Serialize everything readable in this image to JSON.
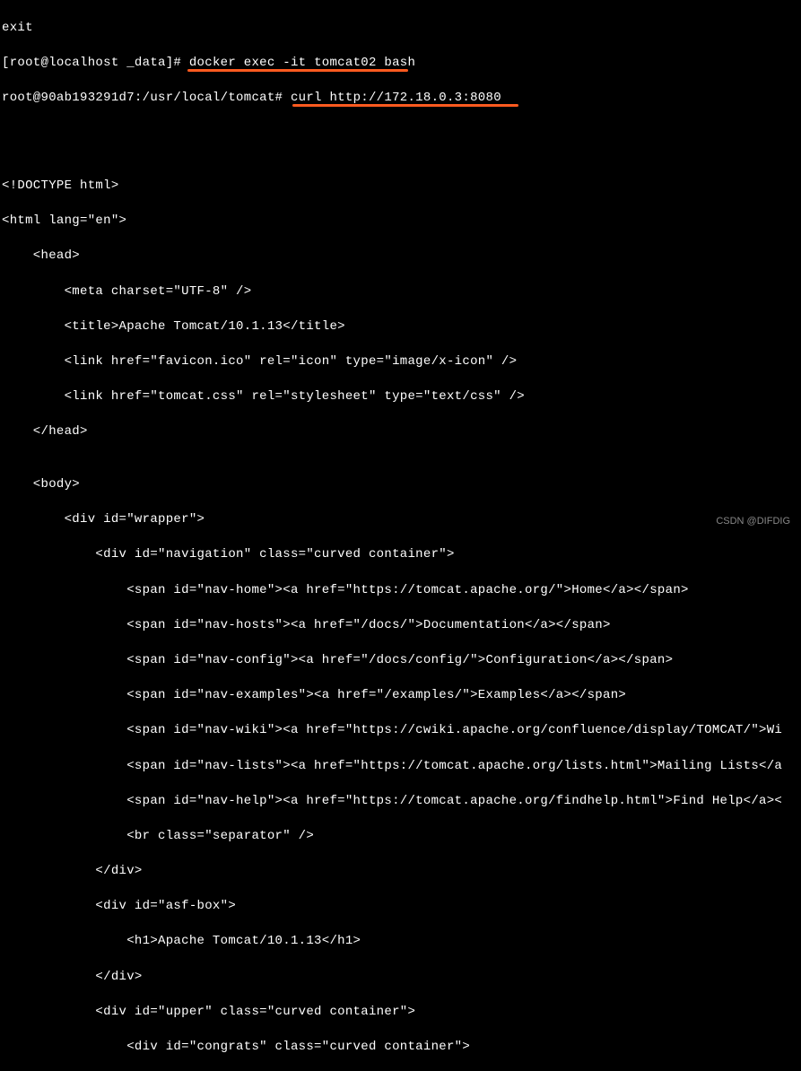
{
  "lines": {
    "l0": "exit",
    "l1_prompt": "[root@localhost _data]# ",
    "l1_cmd": "docker exec -it tomcat02 bash",
    "l2_prompt": "root@90ab193291d7:/usr/local/tomcat# ",
    "l2_cmd": "curl http://172.18.0.3:8080",
    "l3": "",
    "l4": "",
    "l5": "",
    "l6": "<!DOCTYPE html>",
    "l7": "<html lang=\"en\">",
    "l8": "    <head>",
    "l9": "        <meta charset=\"UTF-8\" />",
    "l10": "        <title>Apache Tomcat/10.1.13</title>",
    "l11": "        <link href=\"favicon.ico\" rel=\"icon\" type=\"image/x-icon\" />",
    "l12": "        <link href=\"tomcat.css\" rel=\"stylesheet\" type=\"text/css\" />",
    "l13": "    </head>",
    "l14": "",
    "l15": "    <body>",
    "l16": "        <div id=\"wrapper\">",
    "l17": "            <div id=\"navigation\" class=\"curved container\">",
    "l18": "                <span id=\"nav-home\"><a href=\"https://tomcat.apache.org/\">Home</a></span>",
    "l19": "                <span id=\"nav-hosts\"><a href=\"/docs/\">Documentation</a></span>",
    "l20": "                <span id=\"nav-config\"><a href=\"/docs/config/\">Configuration</a></span>",
    "l21": "                <span id=\"nav-examples\"><a href=\"/examples/\">Examples</a></span>",
    "l22": "                <span id=\"nav-wiki\"><a href=\"https://cwiki.apache.org/confluence/display/TOMCAT/\">Wi",
    "l23": "                <span id=\"nav-lists\"><a href=\"https://tomcat.apache.org/lists.html\">Mailing Lists</a",
    "l24": "                <span id=\"nav-help\"><a href=\"https://tomcat.apache.org/findhelp.html\">Find Help</a><",
    "l25": "                <br class=\"separator\" />",
    "l26": "            </div>",
    "l27": "            <div id=\"asf-box\">",
    "l28": "                <h1>Apache Tomcat/10.1.13</h1>",
    "l29": "            </div>",
    "l30": "            <div id=\"upper\" class=\"curved container\">",
    "l31": "                <div id=\"congrats\" class=\"curved container\">"
  },
  "watermark": "CSDN @DIFDIG"
}
